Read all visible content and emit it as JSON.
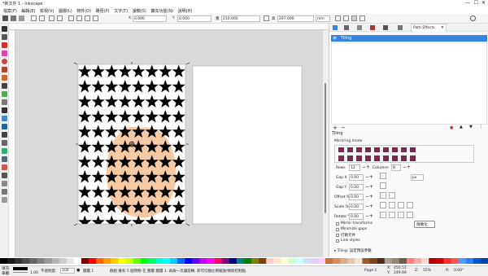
{
  "window": {
    "title": "*新文件 1 - Inkscape"
  },
  "menu": [
    "檔案(F)",
    "編輯(E)",
    "檢視(V)",
    "圖層(L)",
    "物件(O)",
    "路徑(P)",
    "文字(T)",
    "濾鏡(S)",
    "擴充功能(N)",
    "說明(H)"
  ],
  "toolbar": {
    "x_label": "X",
    "x_value": "0.000",
    "y_label": "Y",
    "y_value": "0.000",
    "w_label": "寬",
    "w_value": "210.000",
    "h_label": "高",
    "h_value": "297.000",
    "unit": "mm"
  },
  "panel": {
    "tabs": [
      "Path Effects"
    ],
    "effect_item": "Tiling",
    "section_title": "Tiling",
    "mirroring_label": "Mirroring mode",
    "rows_label": "Rows",
    "rows_value": "12",
    "columns_label": "Columns",
    "columns_value": "8",
    "gapx_label": "Gap X",
    "gapx_value": "0.00",
    "gapx_unit": "px",
    "gapy_label": "Gap Y",
    "gapy_value": "0.00",
    "offset_label": "Offset %",
    "offset_value": "0.00",
    "scale_label": "Scale %",
    "scale_value": "0.00",
    "rotate_label": "Rotate °",
    "rotate_value": "0.00",
    "checks": [
      "Mirror transforms",
      "Minimize gaps",
      "打散元件",
      "Link styles"
    ],
    "tooltip": "隨機化",
    "footer": "▸ Tiling: 設定預設參數"
  },
  "status": {
    "fill_label": "填充:",
    "stroke_label": "筆觸:",
    "stroke_value": "1.00",
    "opacity_label": "不透明度:",
    "opacity_value": "100",
    "layer": "圖層 1",
    "message": "群組 擁有 5 個項物 在 圖層 圖層 1. 再按一次讓旋轉, 即可切換比例縮放/傾斜控制點.",
    "x_label": "X:",
    "x_value": "450.51",
    "y_label": "Y:",
    "y_value": "249.69",
    "zoom_label": "Z:",
    "zoom_value": "55%",
    "rotate_label": "R:",
    "rotate_value": "0.00°",
    "page_label": "Page 1"
  },
  "colors": {
    "accent": "#3584e4",
    "star": "#000000",
    "shape": "#f5c9a4",
    "canvas": "#d9d9d9"
  }
}
